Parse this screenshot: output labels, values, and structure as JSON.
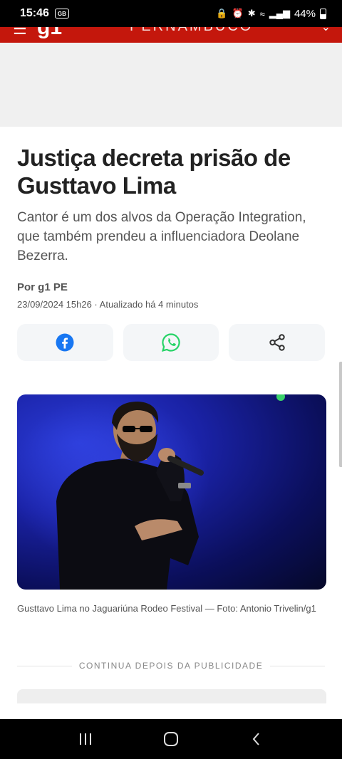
{
  "status_bar": {
    "time": "15:46",
    "left_icon_text": "GB",
    "battery_text": "44%"
  },
  "header": {
    "logo": "g1",
    "region": "PERNAMBUCO",
    "brand_color": "#c4170c"
  },
  "article": {
    "headline": "Justiça decreta prisão de Gusttavo Lima",
    "subtitle": "Cantor é um dos alvos da Operação Integration, que também prendeu a influenciadora Deolane Bezerra.",
    "byline": "Por g1 PE",
    "date": "23/09/2024 15h26 · Atualizado há 4 minutos",
    "share_buttons": [
      {
        "icon": "facebook-icon",
        "color": "#1877f2"
      },
      {
        "icon": "whatsapp-icon",
        "color": "#25d366"
      },
      {
        "icon": "share-icon",
        "color": "#333333"
      }
    ],
    "photo_caption": "Gusttavo Lima no Jaguariúna Rodeo Festival — Foto: Antonio Trivelin/g1",
    "ad_label": "CONTINUA DEPOIS DA PUBLICIDADE"
  },
  "nav_bar": {
    "buttons": [
      "recent-apps-icon",
      "home-icon",
      "back-icon"
    ]
  }
}
